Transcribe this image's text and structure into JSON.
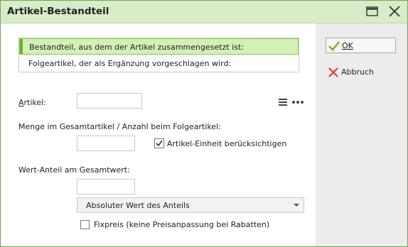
{
  "window": {
    "title": "Artikel-Bestandteil"
  },
  "list": {
    "items": [
      {
        "label": "Bestandteil, aus dem der Artikel zusammengesetzt ist:",
        "selected": true
      },
      {
        "label": "Folgeartikel, der als Ergänzung vorgeschlagen wird:",
        "selected": false
      }
    ]
  },
  "artikel": {
    "label": "Artikel:",
    "value": ""
  },
  "menge": {
    "label": "Menge im Gesamtartikel / Anzahl beim Folgeartikel:",
    "value": "",
    "einheit_label": "Artikel-Einheit berücksichtigen",
    "einheit_checked": true
  },
  "wert": {
    "label": "Wert-Anteil am Gesamtwert:",
    "value": "",
    "mode_selected": "Absoluter Wert des Anteils"
  },
  "fixpreis": {
    "label": "Fixpreis (keine Preisanpassung bei Rabatten)",
    "checked": false
  },
  "buttons": {
    "ok_label": "OK",
    "cancel_label": "Abbruch"
  },
  "colors": {
    "accent": "#6ab42b",
    "titlebar": "#d8ecc8",
    "selection": "#d3f0b6",
    "cancel": "#e03a3a"
  }
}
